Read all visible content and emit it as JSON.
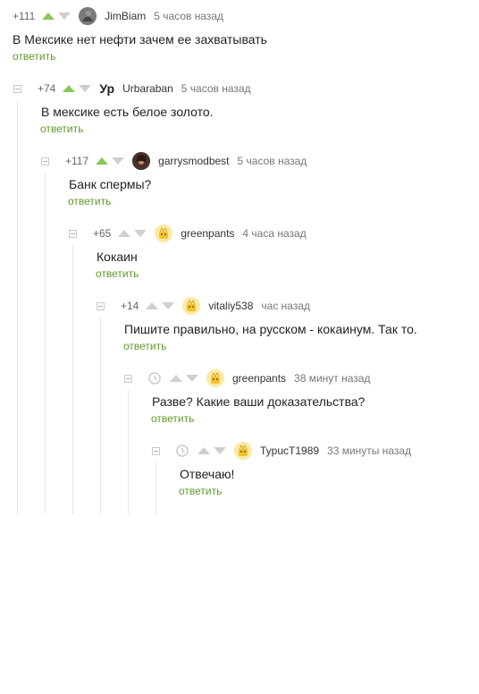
{
  "reply_label": "ответить",
  "accent_color": "#8ac858",
  "comments": [
    {
      "rating": "+111",
      "author": "JimBiam",
      "time": "5 часов назад",
      "text": "В Мексике нет нефти зачем ее захватывать",
      "avatar": "photo-avatar",
      "upvoted": true
    },
    {
      "rating": "+74",
      "author": "Urbaraban",
      "time": "5 часов назад",
      "text": "В мексике есть белое золото.",
      "avatar": "text-avatar",
      "avatar_text": "Ур",
      "upvoted": true
    },
    {
      "rating": "+117",
      "author": "garrysmodbest",
      "time": "5 часов назад",
      "text": "Банк спермы?",
      "avatar": "photo-avatar",
      "upvoted": true
    },
    {
      "rating": "+65",
      "author": "greenpants",
      "time": "4 часа назад",
      "text": "Кокаин",
      "avatar": "pikabu-avatar",
      "upvoted": false
    },
    {
      "rating": "+14",
      "author": "vitaliy538",
      "time": "час назад",
      "text": "Пишите правильно, на русском  - кокаинум. Так то.",
      "avatar": "pikabu-avatar",
      "upvoted": false
    },
    {
      "rating": "",
      "author": "greenpants",
      "time": "38 минут назад",
      "text": "Разве? Какие ваши доказательства?",
      "avatar": "pikabu-avatar",
      "upvoted": false,
      "pending_icon": "clock-icon"
    },
    {
      "rating": "",
      "author": "TypucT1989",
      "time": "33 минуты назад",
      "text": "Отвечаю!",
      "avatar": "pikabu-avatar",
      "upvoted": false,
      "pending_icon": "clock-icon"
    }
  ]
}
